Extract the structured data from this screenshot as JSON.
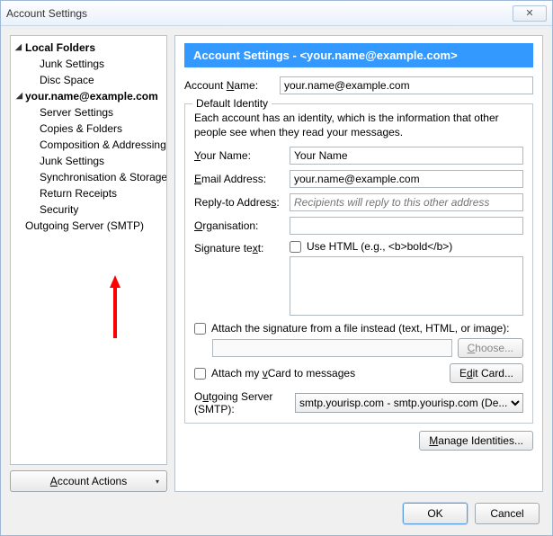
{
  "window": {
    "title": "Account Settings"
  },
  "sidebar": {
    "local_folders": "Local Folders",
    "items_local": [
      "Junk Settings",
      "Disc Space"
    ],
    "account": "your.name@example.com",
    "items_account": [
      "Server Settings",
      "Copies & Folders",
      "Composition & Addressing",
      "Junk Settings",
      "Synchronisation & Storage",
      "Return Receipts",
      "Security"
    ],
    "smtp": "Outgoing Server (SMTP)",
    "account_actions": "Account Actions"
  },
  "panel": {
    "header_prefix": "Account Settings - ",
    "header_email": "<your.name@example.com>",
    "account_name_label": "Account Name:",
    "account_name_value": "your.name@example.com",
    "identity_legend": "Default Identity",
    "identity_desc": "Each account has an identity, which is the information that other people see when they read your messages.",
    "your_name_label": "Your Name:",
    "your_name_value": "Your Name",
    "email_label": "Email Address:",
    "email_value": "your.name@example.com",
    "reply_label": "Reply-to Address:",
    "reply_placeholder": "Recipients will reply to this other address",
    "org_label": "Organisation:",
    "sig_label": "Signature text:",
    "use_html": "Use HTML (e.g., <b>bold</b>)",
    "attach_file": "Attach the signature from a file instead (text, HTML, or image):",
    "choose_btn": "Choose...",
    "attach_vcard": "Attach my vCard to messages",
    "edit_card": "Edit Card...",
    "smtp_label": "Outgoing Server (SMTP):",
    "smtp_value": "smtp.yourisp.com - smtp.yourisp.com (De...",
    "manage": "Manage Identities..."
  },
  "footer": {
    "ok": "OK",
    "cancel": "Cancel"
  }
}
